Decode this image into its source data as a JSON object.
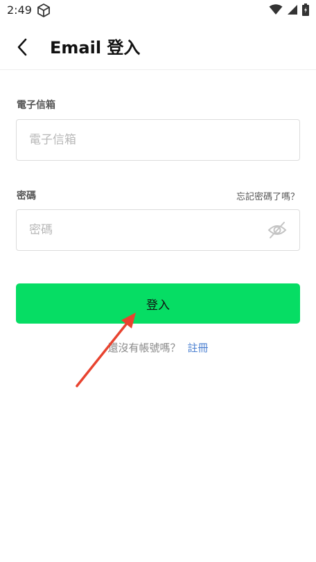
{
  "status_bar": {
    "time": "2:49",
    "icons": [
      "cube-icon",
      "wifi-icon",
      "signal-icon",
      "battery-icon"
    ]
  },
  "header": {
    "title": "Email 登入",
    "back_icon": "chevron-left-icon"
  },
  "form": {
    "email": {
      "label": "電子信箱",
      "placeholder": "電子信箱",
      "value": ""
    },
    "password": {
      "label": "密碼",
      "placeholder": "密碼",
      "value": "",
      "forgot_label": "忘記密碼了嗎？",
      "visibility_icon": "eye-off-icon"
    },
    "submit_label": "登入"
  },
  "signup": {
    "prompt": "還沒有帳號嗎？",
    "link_label": "註冊"
  },
  "colors": {
    "primary_green": "#06dd64",
    "link_blue": "#4a7fd0",
    "annotation_red": "#e8432f"
  }
}
